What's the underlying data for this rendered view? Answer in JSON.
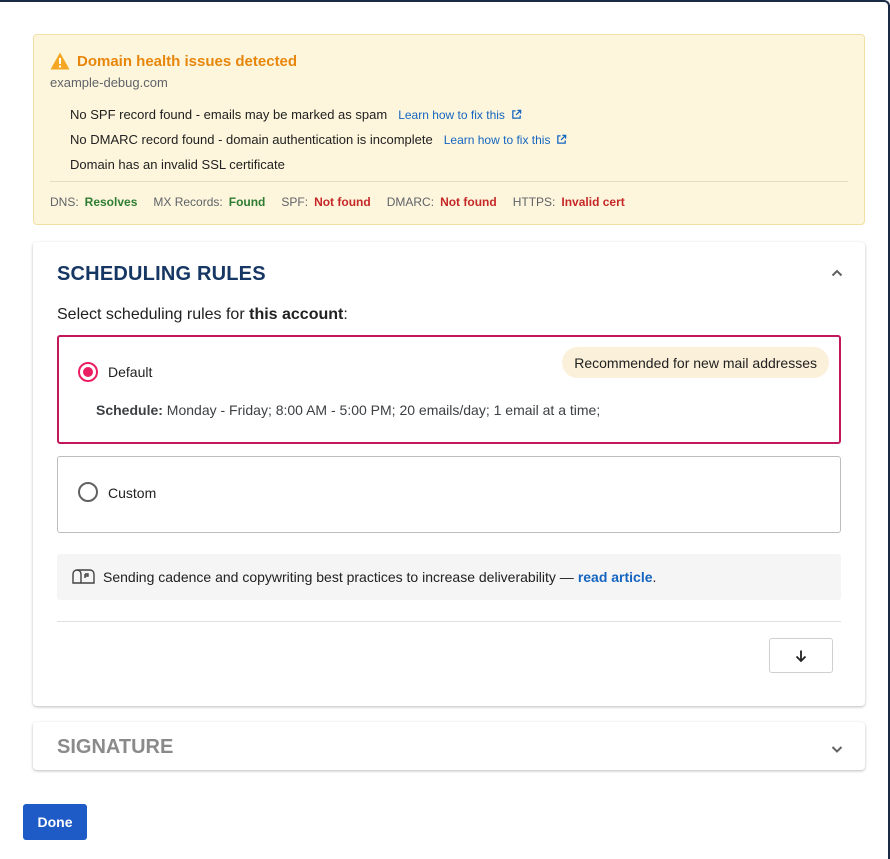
{
  "health": {
    "title": "Domain health issues detected",
    "domain": "example-debug.com",
    "issues": [
      {
        "text": "No SPF record found - emails may be marked as spam",
        "link": "Learn how to fix this"
      },
      {
        "text": "No DMARC record found - domain authentication is incomplete",
        "link": "Learn how to fix this"
      },
      {
        "text": "Domain has an invalid SSL certificate",
        "link": ""
      }
    ],
    "checks": [
      {
        "key": "DNS:",
        "value": "Resolves",
        "status": "ok"
      },
      {
        "key": "MX Records:",
        "value": "Found",
        "status": "ok"
      },
      {
        "key": "SPF:",
        "value": "Not found",
        "status": "bad"
      },
      {
        "key": "DMARC:",
        "value": "Not found",
        "status": "bad"
      },
      {
        "key": "HTTPS:",
        "value": "Invalid cert",
        "status": "bad"
      }
    ]
  },
  "scheduling": {
    "title": "SCHEDULING RULES",
    "subtitle_prefix": "Select scheduling rules for ",
    "subtitle_bold": "this account",
    "subtitle_suffix": ":",
    "default_label": "Default",
    "recommended": "Recommended for new mail addresses",
    "schedule_label": "Schedule:",
    "schedule_value": "Monday - Friday; 8:00 AM - 5:00 PM; 20 emails/day; 1 email at a time;",
    "custom_label": "Custom",
    "tip_text": "Sending cadence and copywriting best practices to increase deliverability —",
    "tip_link": "read article",
    "tip_end": "."
  },
  "signature": {
    "title": "SIGNATURE"
  },
  "actions": {
    "done": "Done"
  },
  "colors": {
    "accent": "#e91e63",
    "primary": "#1e5bc6",
    "warning": "#e8860c",
    "ok": "#2e7d32",
    "bad": "#c62828"
  },
  "icons": {
    "warning": "warning-triangle-icon",
    "external": "external-link-icon",
    "mailbox": "mailbox-icon",
    "down": "arrow-down-icon"
  }
}
